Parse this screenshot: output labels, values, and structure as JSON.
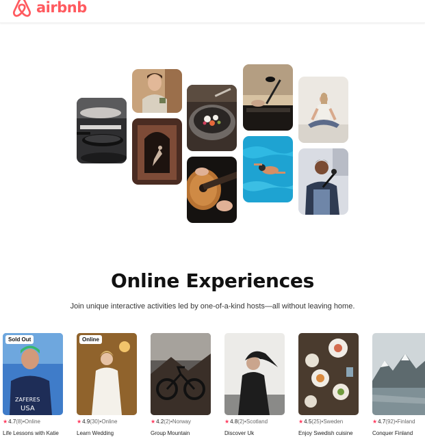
{
  "header": {
    "logo_text": "airbnb",
    "brand_color": "#ff5a5f",
    "logo_icon": "airbnb-belo-icon"
  },
  "hero": {
    "title": "Online Experiences",
    "subtitle": "Join unique interactive activities led by one-of-a-kind hosts—all without leaving home."
  },
  "collage": [
    {
      "name": "cooking-photo"
    },
    {
      "name": "host-with-tea-photo"
    },
    {
      "name": "dancer-photo"
    },
    {
      "name": "food-bowl-photo"
    },
    {
      "name": "guitar-photo"
    },
    {
      "name": "dj-microphone-photo"
    },
    {
      "name": "swimmer-photo"
    },
    {
      "name": "yoga-photo"
    },
    {
      "name": "singer-photo"
    }
  ],
  "experiences": [
    {
      "badge": "Sold Out",
      "rating": "4.7",
      "count": "(8)",
      "location": "•Online",
      "title": "Life Lessons with Katie"
    },
    {
      "badge": "Online",
      "rating": "4.9",
      "count": "(30)",
      "location": "•Online",
      "title": "Learn Wedding"
    },
    {
      "badge": "",
      "rating": "4.2",
      "count": "(2)",
      "location": "•Norway",
      "title": "Group Mountain"
    },
    {
      "badge": "",
      "rating": "4.8",
      "count": "(2)",
      "location": "•Scotland",
      "title": "Discover Uk"
    },
    {
      "badge": "",
      "rating": "4.5",
      "count": "(25)",
      "location": "•Sweden",
      "title": "Enjoy Swedish cuisine"
    },
    {
      "badge": "",
      "rating": "4.7",
      "count": "(92)",
      "location": "•Finland",
      "title": "Conquer Finland"
    }
  ],
  "icons": {
    "star": "★"
  }
}
